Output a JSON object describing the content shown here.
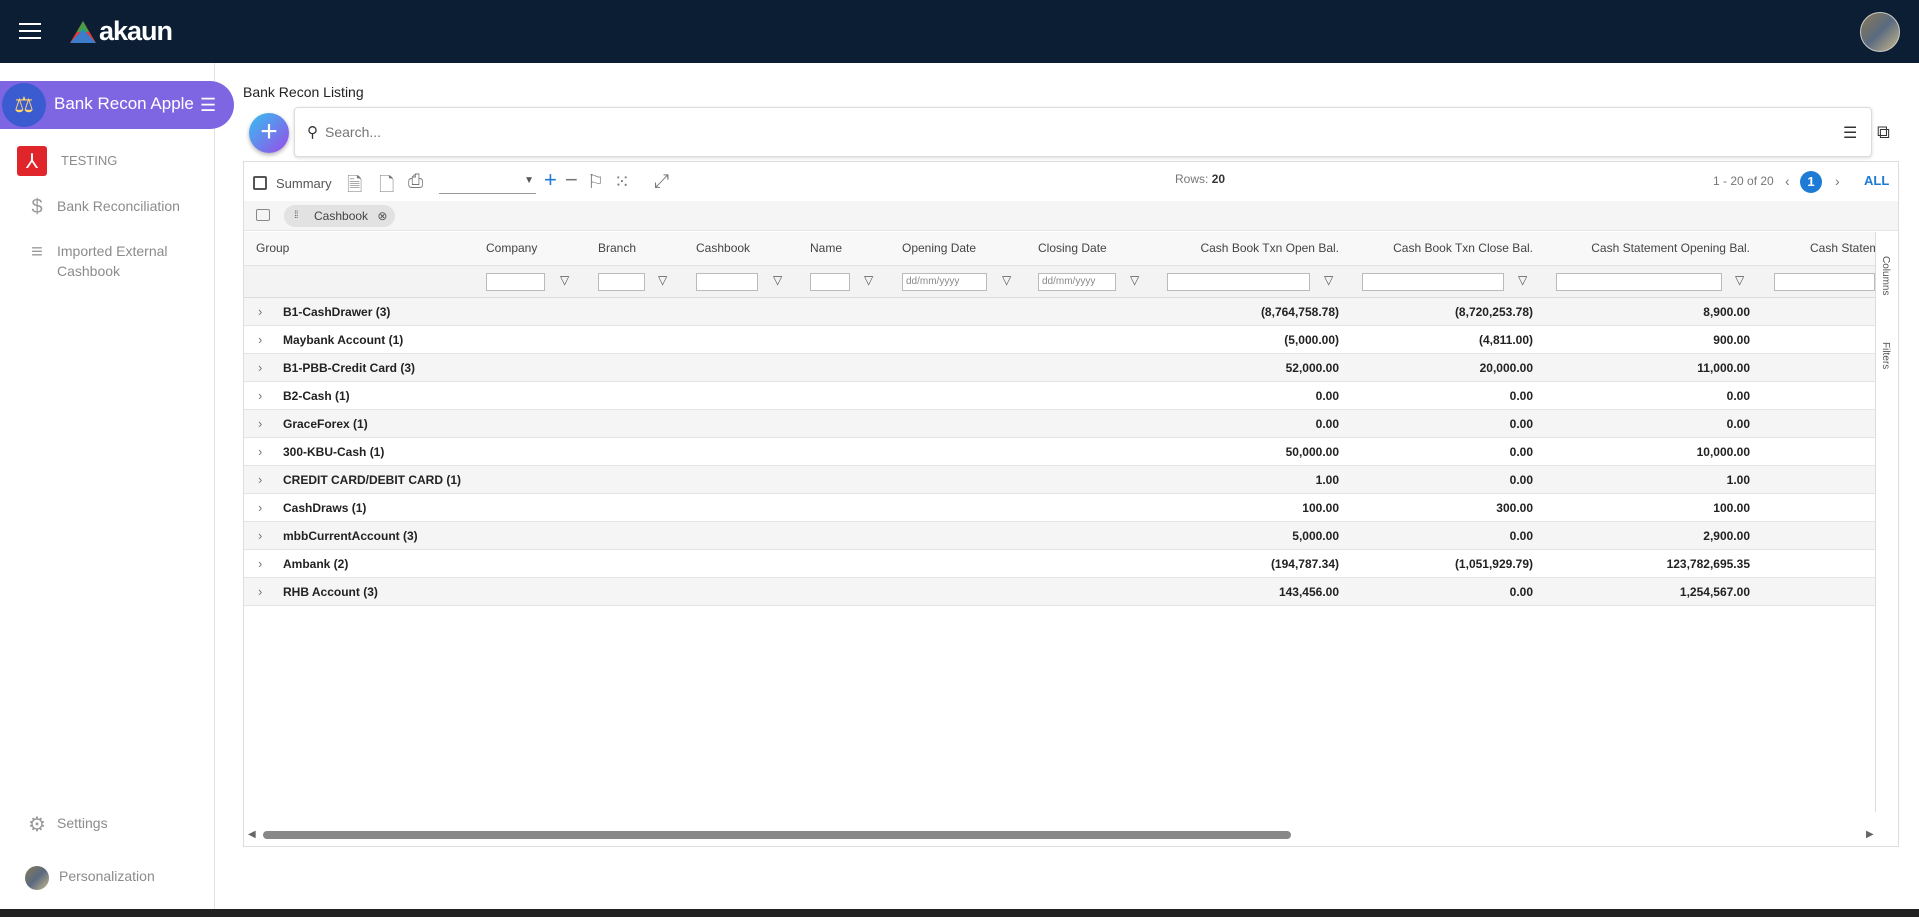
{
  "app": {
    "brand": "akaun"
  },
  "sidebar": {
    "app_title": "Bank Recon Apple",
    "items": [
      {
        "label": "TESTING",
        "icon": "testing-logo-icon"
      },
      {
        "label": "Bank Reconciliation",
        "icon": "dollar-icon"
      },
      {
        "label": "Imported External Cashbook",
        "icon": "playlist-add-icon"
      }
    ],
    "settings_label": "Settings",
    "personalization_label": "Personalization"
  },
  "main": {
    "title": "Bank Recon Listing",
    "search_placeholder": "Search..."
  },
  "toolbar": {
    "summary_label": "Summary",
    "rows_label": "Rows:",
    "rows_value": "20",
    "page_range": "1 - 20 of 20",
    "page_number": "1",
    "all_label": "ALL"
  },
  "grouping": {
    "chip_label": "Cashbook"
  },
  "columns": {
    "group": "Group",
    "company": "Company",
    "branch": "Branch",
    "cashbook": "Cashbook",
    "name": "Name",
    "opening_date": "Opening Date",
    "closing_date": "Closing Date",
    "cb_open": "Cash Book Txn Open Bal.",
    "cb_close": "Cash Book Txn Close Bal.",
    "cs_open": "Cash Statement Opening Bal.",
    "cs_more": "Cash Statem"
  },
  "filters": {
    "date_placeholder": "dd/mm/yyyy"
  },
  "side_tabs": {
    "columns": "Columns",
    "filters": "Filters"
  },
  "rows": [
    {
      "group": "B1-CashDrawer (3)",
      "cb_open": "(8,764,758.78)",
      "cb_close": "(8,720,253.78)",
      "cs_open": "8,900.00"
    },
    {
      "group": "Maybank Account (1)",
      "cb_open": "(5,000.00)",
      "cb_close": "(4,811.00)",
      "cs_open": "900.00"
    },
    {
      "group": "B1-PBB-Credit Card (3)",
      "cb_open": "52,000.00",
      "cb_close": "20,000.00",
      "cs_open": "11,000.00"
    },
    {
      "group": "B2-Cash (1)",
      "cb_open": "0.00",
      "cb_close": "0.00",
      "cs_open": "0.00"
    },
    {
      "group": "GraceForex (1)",
      "cb_open": "0.00",
      "cb_close": "0.00",
      "cs_open": "0.00"
    },
    {
      "group": "300-KBU-Cash (1)",
      "cb_open": "50,000.00",
      "cb_close": "0.00",
      "cs_open": "10,000.00"
    },
    {
      "group": "CREDIT CARD/DEBIT CARD (1)",
      "cb_open": "1.00",
      "cb_close": "0.00",
      "cs_open": "1.00"
    },
    {
      "group": "CashDraws (1)",
      "cb_open": "100.00",
      "cb_close": "300.00",
      "cs_open": "100.00"
    },
    {
      "group": "mbbCurrentAccount (3)",
      "cb_open": "5,000.00",
      "cb_close": "0.00",
      "cs_open": "2,900.00"
    },
    {
      "group": "Ambank (2)",
      "cb_open": "(194,787.34)",
      "cb_close": "(1,051,929.79)",
      "cs_open": "123,782,695.35"
    },
    {
      "group": "RHB Account (3)",
      "cb_open": "143,456.00",
      "cb_close": "0.00",
      "cs_open": "1,254,567.00"
    }
  ]
}
